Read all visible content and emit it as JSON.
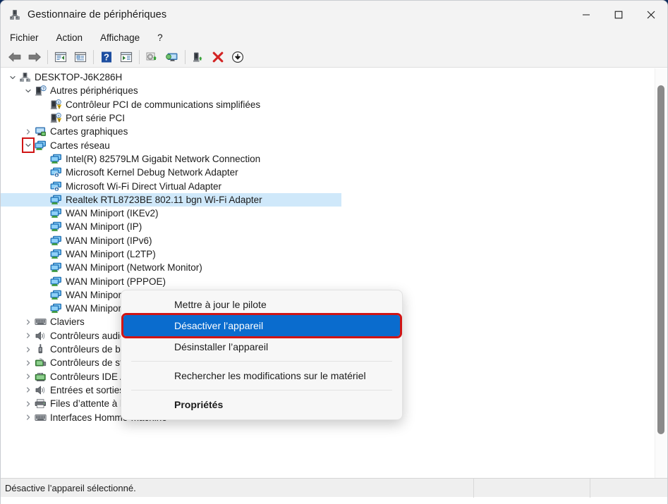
{
  "window": {
    "title": "Gestionnaire de périphériques",
    "icon": "device-manager-icon",
    "controls": {
      "minimize": "minimize-icon",
      "maximize": "maximize-icon",
      "close": "close-icon"
    }
  },
  "menubar": {
    "items": [
      {
        "label": "Fichier"
      },
      {
        "label": "Action"
      },
      {
        "label": "Affichage"
      },
      {
        "label": "?"
      }
    ]
  },
  "toolbar": {
    "buttons": [
      {
        "name": "back-arrow-icon"
      },
      {
        "name": "forward-arrow-icon"
      },
      {
        "name": "up-one-level-icon"
      },
      {
        "name": "properties-icon"
      },
      {
        "name": "help-icon"
      },
      {
        "name": "show-hidden-icon"
      },
      {
        "name": "update-driver-icon"
      },
      {
        "name": "scan-hardware-icon"
      },
      {
        "name": "enable-device-icon"
      },
      {
        "name": "uninstall-device-icon"
      },
      {
        "name": "disable-device-icon"
      }
    ]
  },
  "tree": {
    "rows": [
      {
        "label": "DESKTOP-J6K286H",
        "indent": 0,
        "chevron": "down",
        "icon": "computer-icon",
        "selected": false,
        "highlight_chevron": false
      },
      {
        "label": "Autres périphériques",
        "indent": 1,
        "chevron": "down",
        "icon": "unknown-device-icon",
        "selected": false,
        "highlight_chevron": false
      },
      {
        "label": "Contrôleur PCI de communications simplifiées",
        "indent": 2,
        "chevron": "none",
        "icon": "warning-device-icon",
        "selected": false,
        "highlight_chevron": false
      },
      {
        "label": "Port série PCI",
        "indent": 2,
        "chevron": "none",
        "icon": "warning-device-icon",
        "selected": false,
        "highlight_chevron": false
      },
      {
        "label": "Cartes graphiques",
        "indent": 1,
        "chevron": "right",
        "icon": "display-adapter-icon",
        "selected": false,
        "highlight_chevron": false
      },
      {
        "label": "Cartes réseau",
        "indent": 1,
        "chevron": "down",
        "icon": "network-adapter-icon",
        "selected": false,
        "highlight_chevron": true
      },
      {
        "label": "Intel(R) 82579LM Gigabit Network Connection",
        "indent": 2,
        "chevron": "none",
        "icon": "network-card-icon",
        "selected": false,
        "highlight_chevron": false
      },
      {
        "label": "Microsoft Kernel Debug Network Adapter",
        "indent": 2,
        "chevron": "none",
        "icon": "virtual-network-icon",
        "selected": false,
        "highlight_chevron": false
      },
      {
        "label": "Microsoft Wi-Fi Direct Virtual Adapter",
        "indent": 2,
        "chevron": "none",
        "icon": "virtual-network-icon",
        "selected": false,
        "highlight_chevron": false
      },
      {
        "label": "Realtek RTL8723BE 802.11 bgn Wi-Fi Adapter",
        "indent": 2,
        "chevron": "none",
        "icon": "network-card-icon",
        "selected": true,
        "highlight_chevron": false
      },
      {
        "label": "WAN Miniport (IKEv2)",
        "indent": 2,
        "chevron": "none",
        "icon": "network-card-icon",
        "selected": false,
        "highlight_chevron": false
      },
      {
        "label": "WAN Miniport (IP)",
        "indent": 2,
        "chevron": "none",
        "icon": "network-card-icon",
        "selected": false,
        "highlight_chevron": false
      },
      {
        "label": "WAN Miniport (IPv6)",
        "indent": 2,
        "chevron": "none",
        "icon": "network-card-icon",
        "selected": false,
        "highlight_chevron": false
      },
      {
        "label": "WAN Miniport (L2TP)",
        "indent": 2,
        "chevron": "none",
        "icon": "network-card-icon",
        "selected": false,
        "highlight_chevron": false
      },
      {
        "label": "WAN Miniport (Network Monitor)",
        "indent": 2,
        "chevron": "none",
        "icon": "network-card-icon",
        "selected": false,
        "highlight_chevron": false
      },
      {
        "label": "WAN Miniport (PPPOE)",
        "indent": 2,
        "chevron": "none",
        "icon": "network-card-icon",
        "selected": false,
        "highlight_chevron": false
      },
      {
        "label": "WAN Miniport (PPTP)",
        "indent": 2,
        "chevron": "none",
        "icon": "network-card-icon",
        "selected": false,
        "highlight_chevron": false
      },
      {
        "label": "WAN Miniport (SSTP)",
        "indent": 2,
        "chevron": "none",
        "icon": "network-card-icon",
        "selected": false,
        "highlight_chevron": false
      },
      {
        "label": "Claviers",
        "indent": 1,
        "chevron": "right",
        "icon": "keyboard-icon",
        "selected": false,
        "highlight_chevron": false
      },
      {
        "label": "Contrôleurs audio, vidéo et jeu",
        "indent": 1,
        "chevron": "right",
        "icon": "speaker-icon",
        "selected": false,
        "highlight_chevron": false
      },
      {
        "label": "Contrôleurs de bus USB",
        "indent": 1,
        "chevron": "right",
        "icon": "usb-icon",
        "selected": false,
        "highlight_chevron": false
      },
      {
        "label": "Contrôleurs de stockage",
        "indent": 1,
        "chevron": "right",
        "icon": "storage-controller-icon",
        "selected": false,
        "highlight_chevron": false
      },
      {
        "label": "Contrôleurs IDE ATA/ATAPI",
        "indent": 1,
        "chevron": "right",
        "icon": "ide-controller-icon",
        "selected": false,
        "highlight_chevron": false
      },
      {
        "label": "Entrées et sorties audio",
        "indent": 1,
        "chevron": "right",
        "icon": "speaker-icon",
        "selected": false,
        "highlight_chevron": false
      },
      {
        "label": "Files d’attente à l’impression :",
        "indent": 1,
        "chevron": "right",
        "icon": "printer-icon",
        "selected": false,
        "highlight_chevron": false
      },
      {
        "label": "Interfaces Homme-machine",
        "indent": 1,
        "chevron": "right",
        "icon": "keyboard-icon",
        "selected": false,
        "highlight_chevron": false
      }
    ]
  },
  "context_menu": {
    "items": [
      {
        "label": "Mettre à jour le pilote",
        "active": false,
        "bold": false,
        "separator_after": false
      },
      {
        "label": "Désactiver l’appareil",
        "active": true,
        "bold": false,
        "separator_after": false
      },
      {
        "label": "Désinstaller l’appareil",
        "active": false,
        "bold": false,
        "separator_after": true
      },
      {
        "label": "Rechercher les modifications sur le matériel",
        "active": false,
        "bold": false,
        "separator_after": true
      },
      {
        "label": "Propriétés",
        "active": false,
        "bold": true,
        "separator_after": false
      }
    ]
  },
  "statusbar": {
    "message": "Désactive l’appareil sélectionné.",
    "cell2": "",
    "cell3": ""
  },
  "colors": {
    "accent_blue": "#0a6cce",
    "selection_blue": "#cfe8fa",
    "highlight_red": "#d01515",
    "titlebar_bg": "#f3f3f3",
    "menu_bg": "#f7f7f7",
    "status_bg": "#efefef"
  }
}
